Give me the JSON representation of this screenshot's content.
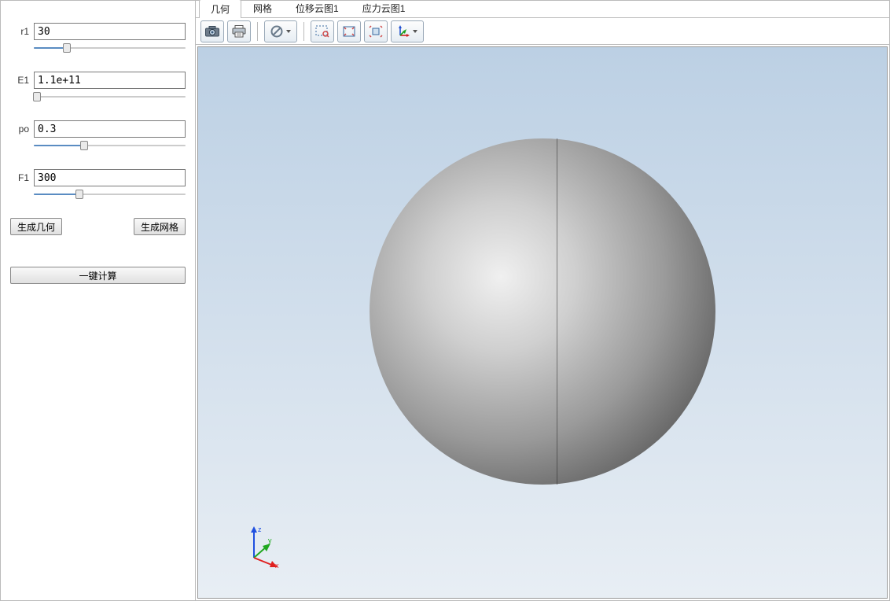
{
  "params": {
    "r1": {
      "label": "r1",
      "value": "30",
      "slider_pct": 22
    },
    "E1": {
      "label": "E1",
      "value": "1.1e+11",
      "slider_pct": 2
    },
    "po": {
      "label": "po",
      "value": "0.3",
      "slider_pct": 33
    },
    "F1": {
      "label": "F1",
      "value": "300",
      "slider_pct": 30
    }
  },
  "buttons": {
    "gen_geom": "生成几何",
    "gen_mesh": "生成网格",
    "compute": "一键计算"
  },
  "tabs": [
    "几何",
    "网格",
    "位移云图1",
    "应力云图1"
  ],
  "active_tab_index": 0,
  "toolbar_icons": {
    "screenshot": "camera-icon",
    "print": "print-icon",
    "reset": "forbid-icon",
    "zoom_box": "zoom-box-icon",
    "zoom_extents": "zoom-extents-icon",
    "zoom_selected": "zoom-selected-icon",
    "axes_dd": "axes-icon"
  },
  "axes": {
    "x": "x",
    "y": "y",
    "z": "z"
  }
}
